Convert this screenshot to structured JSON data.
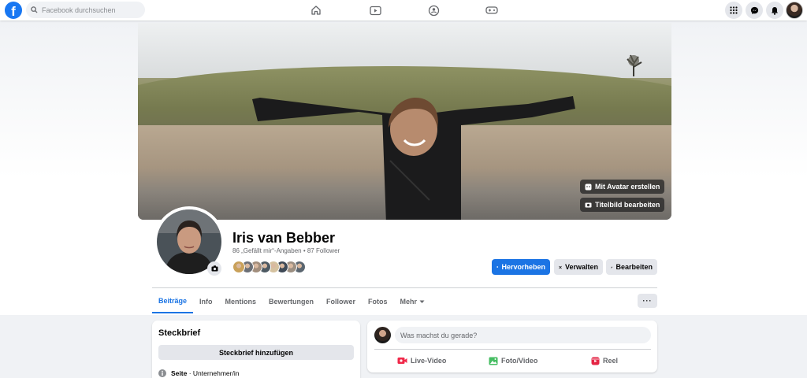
{
  "topbar": {
    "logo_letter": "f",
    "search_placeholder": "Facebook durchsuchen",
    "nav": [
      "home-icon",
      "video-icon",
      "groups-icon",
      "gaming-icon"
    ],
    "right": [
      "menu-grid-icon",
      "messenger-icon",
      "notifications-icon",
      "account-avatar"
    ]
  },
  "cover": {
    "avatar_button": "Mit Avatar erstellen",
    "edit_cover_button": "Titelbild bearbeiten"
  },
  "profile": {
    "name": "Iris van Bebber",
    "stats": "86 „Gefällt mir“-Angaben • 87 Follower",
    "friend_avatar_colors": [
      "#c9a15a",
      "#6b6f76",
      "#a28e7d",
      "#4d5a63",
      "#d5c2a0",
      "#3f4a57",
      "#9c8f82",
      "#5b6670"
    ]
  },
  "actions": {
    "promote": "Hervorheben",
    "manage": "Verwalten",
    "edit": "Bearbeiten"
  },
  "tabs": [
    {
      "label": "Beiträge",
      "active": true
    },
    {
      "label": "Info"
    },
    {
      "label": "Mentions"
    },
    {
      "label": "Bewertungen"
    },
    {
      "label": "Follower"
    },
    {
      "label": "Fotos"
    },
    {
      "label": "Mehr"
    }
  ],
  "more_button": "···",
  "intro": {
    "title": "Steckbrief",
    "add_button": "Steckbrief hinzufügen",
    "row_bold": "Seite",
    "row_text": " · Unternehmer/in"
  },
  "composer": {
    "placeholder": "Was machst du gerade?",
    "live": "Live-Video",
    "photo": "Foto/Video",
    "reel": "Reel"
  },
  "colors": {
    "primary": "#1b74e4",
    "live": "#f02849",
    "photo": "#45bd62",
    "reel": "#e42645"
  }
}
